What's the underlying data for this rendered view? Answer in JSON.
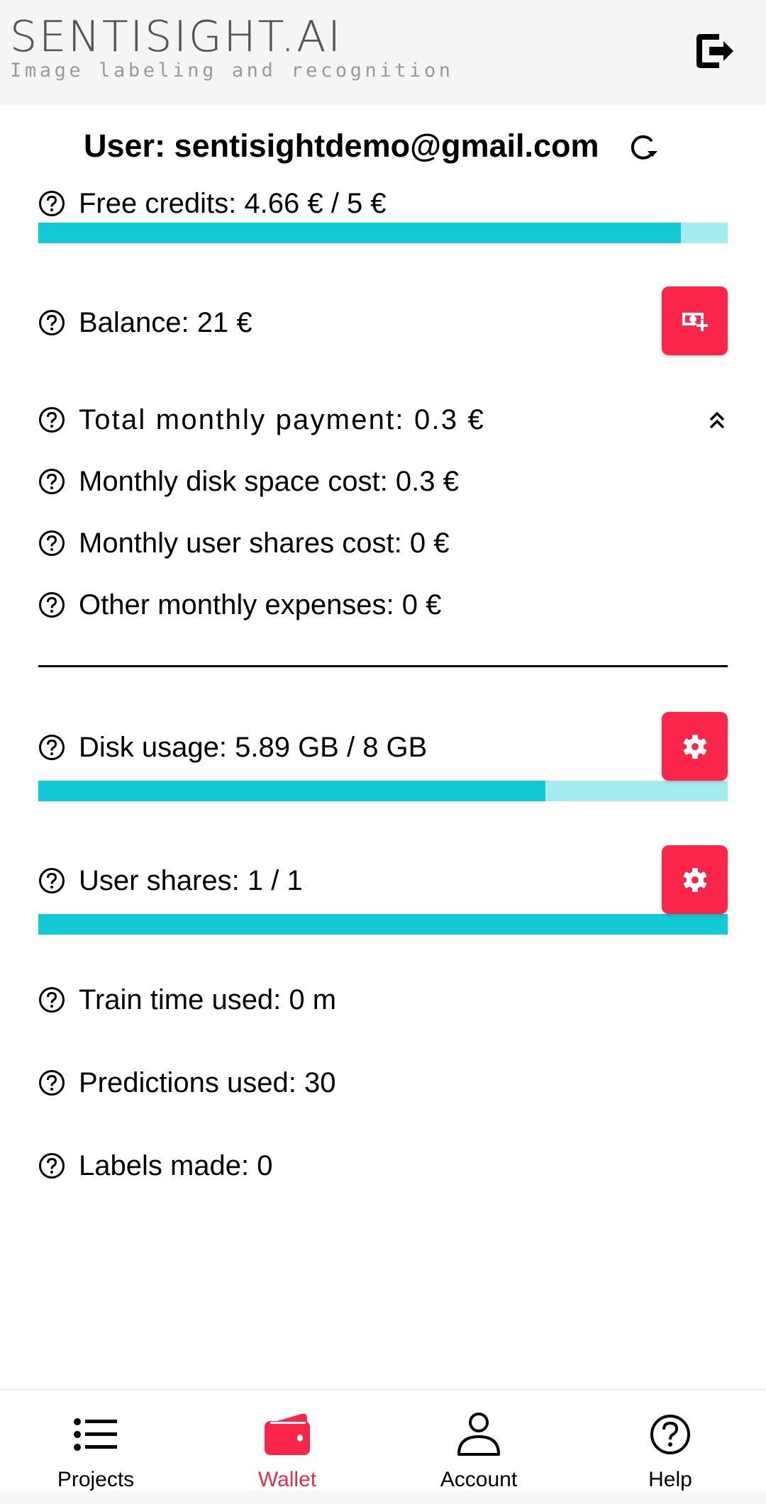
{
  "header": {
    "logo_main_prefix": "SENTISIGHT",
    "logo_dot": ".",
    "logo_main_suffix": "AI",
    "logo_tagline": "Image labeling and recognition",
    "logout_icon": "logout-icon"
  },
  "user": {
    "title": "User: sentisightdemo@gmail.com",
    "refresh_icon": "refresh-icon"
  },
  "wallet": {
    "free_credits": {
      "text": "Free credits: 4.66 € / 5 €",
      "used": 4.66,
      "total": 5,
      "progress_fraction": 0.932
    },
    "balance": {
      "text": "Balance: 21 €",
      "button_icon": "add-money-icon"
    },
    "total_monthly_payment": {
      "text": "Total monthly payment: 0.3 €",
      "toggle_icon": "chevron-double-up-icon"
    },
    "monthly_items": [
      {
        "text": "Monthly disk space cost: 0.3 €"
      },
      {
        "text": "Monthly user shares cost: 0 €"
      },
      {
        "text": "Other monthly expenses: 0 €"
      }
    ],
    "disk_usage": {
      "text": "Disk usage: 5.89 GB / 8 GB",
      "used_gb": 5.89,
      "total_gb": 8,
      "progress_fraction": 0.736,
      "button_icon": "gear-icon"
    },
    "user_shares": {
      "text": "User shares: 1 / 1",
      "used": 1,
      "total": 1,
      "progress_fraction": 1.0,
      "button_icon": "gear-icon"
    },
    "stats": [
      {
        "text": "Train time used: 0 m"
      },
      {
        "text": "Predictions used: 30"
      },
      {
        "text": "Labels made: 0"
      }
    ]
  },
  "bottom_nav": {
    "items": [
      {
        "label": "Projects",
        "icon": "list-icon",
        "active": false
      },
      {
        "label": "Wallet",
        "icon": "wallet-icon",
        "active": true
      },
      {
        "label": "Account",
        "icon": "person-icon",
        "active": false
      },
      {
        "label": "Help",
        "icon": "help-circle-icon",
        "active": false
      }
    ]
  },
  "colors": {
    "accent_red": "#fa2649",
    "active_nav_red": "#e03048",
    "progress_fill": "#13c9d4",
    "progress_track": "#a6ebee",
    "header_bg": "#f5f5f5"
  }
}
